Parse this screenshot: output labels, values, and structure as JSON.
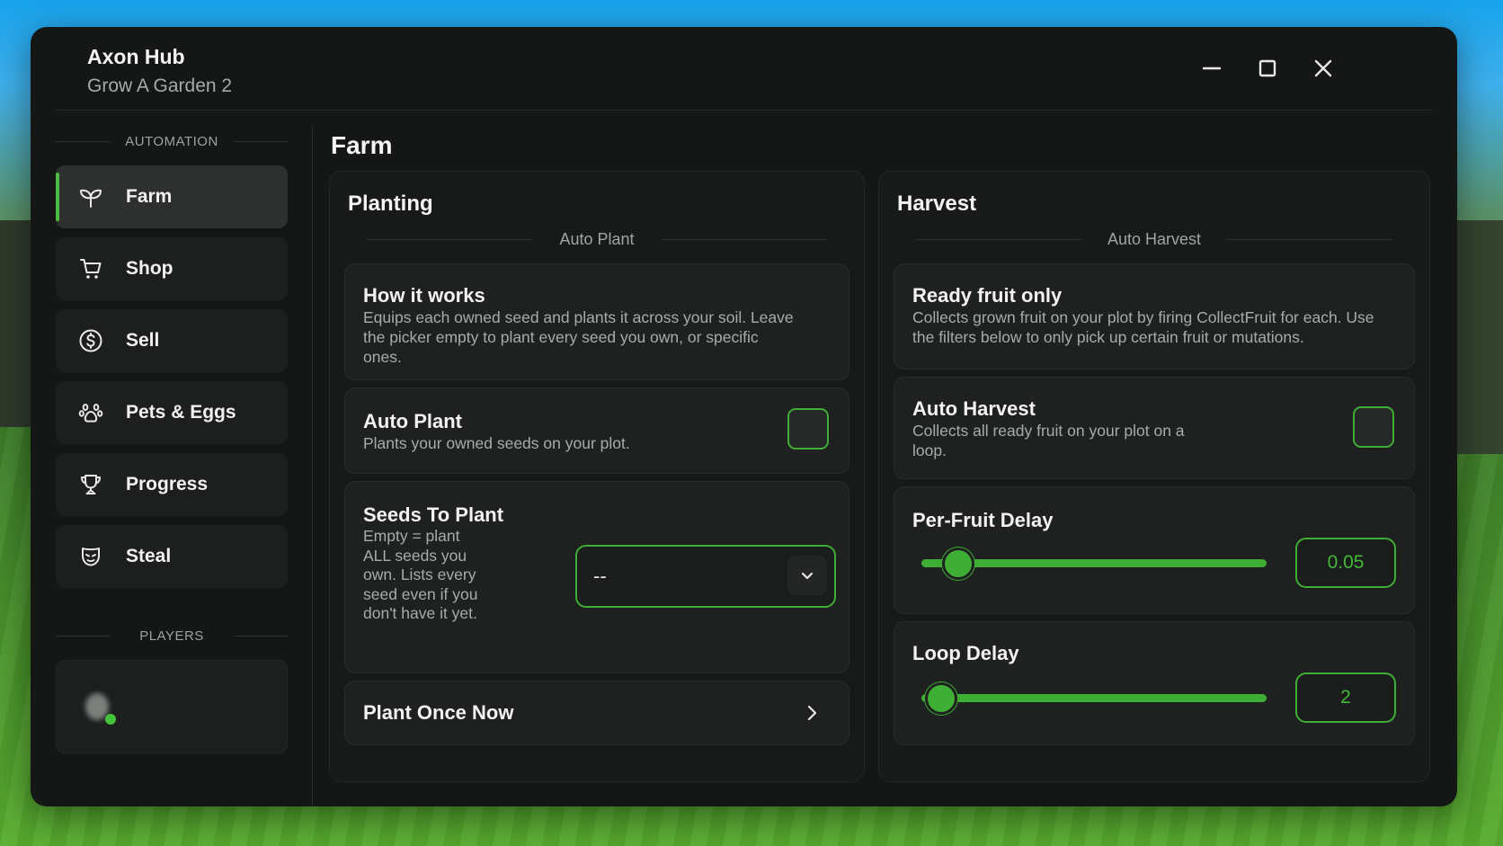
{
  "window": {
    "title": "Axon Hub",
    "subtitle": "Grow A Garden 2"
  },
  "window_controls": [
    "minimize-icon",
    "maximize-icon",
    "close-icon"
  ],
  "sidebar": {
    "section_automation": "AUTOMATION",
    "items": [
      {
        "label": "Farm",
        "icon": "sprout-icon",
        "active": true
      },
      {
        "label": "Shop",
        "icon": "cart-icon",
        "active": false
      },
      {
        "label": "Sell",
        "icon": "dollar-icon",
        "active": false
      },
      {
        "label": "Pets & Eggs",
        "icon": "paw-icon",
        "active": false
      },
      {
        "label": "Progress",
        "icon": "trophy-icon",
        "active": false
      },
      {
        "label": "Steal",
        "icon": "mask-icon",
        "active": false
      }
    ],
    "section_players": "PLAYERS"
  },
  "page": {
    "title": "Farm"
  },
  "planting": {
    "title": "Planting",
    "subsection": "Auto Plant",
    "how": {
      "title": "How it works",
      "desc": "Equips each owned seed and plants it across your soil. Leave the picker empty to plant every seed you own, or specific ones."
    },
    "auto_plant": {
      "title": "Auto Plant",
      "desc": "Plants your owned seeds on your plot.",
      "enabled": false
    },
    "seeds": {
      "title": "Seeds To Plant",
      "desc": "Empty = plant ALL seeds you own. Lists every seed even if you don't have it yet.",
      "value": "--"
    },
    "plant_once": {
      "label": "Plant Once Now"
    }
  },
  "harvest": {
    "title": "Harvest",
    "subsection": "Auto Harvest",
    "ready": {
      "title": "Ready fruit only",
      "desc": "Collects grown fruit on your plot by firing CollectFruit for each. Use the filters below to only pick up certain fruit or mutations."
    },
    "auto_harvest": {
      "title": "Auto Harvest",
      "desc": "Collects all ready fruit on your plot on a loop.",
      "enabled": false
    },
    "per_fruit_delay": {
      "title": "Per-Fruit Delay",
      "value": "0.05",
      "fraction": 0.1
    },
    "loop_delay": {
      "title": "Loop Delay",
      "value": "2",
      "fraction": 0.05
    }
  },
  "colors": {
    "accent": "#3fae34",
    "background": "#151716"
  }
}
